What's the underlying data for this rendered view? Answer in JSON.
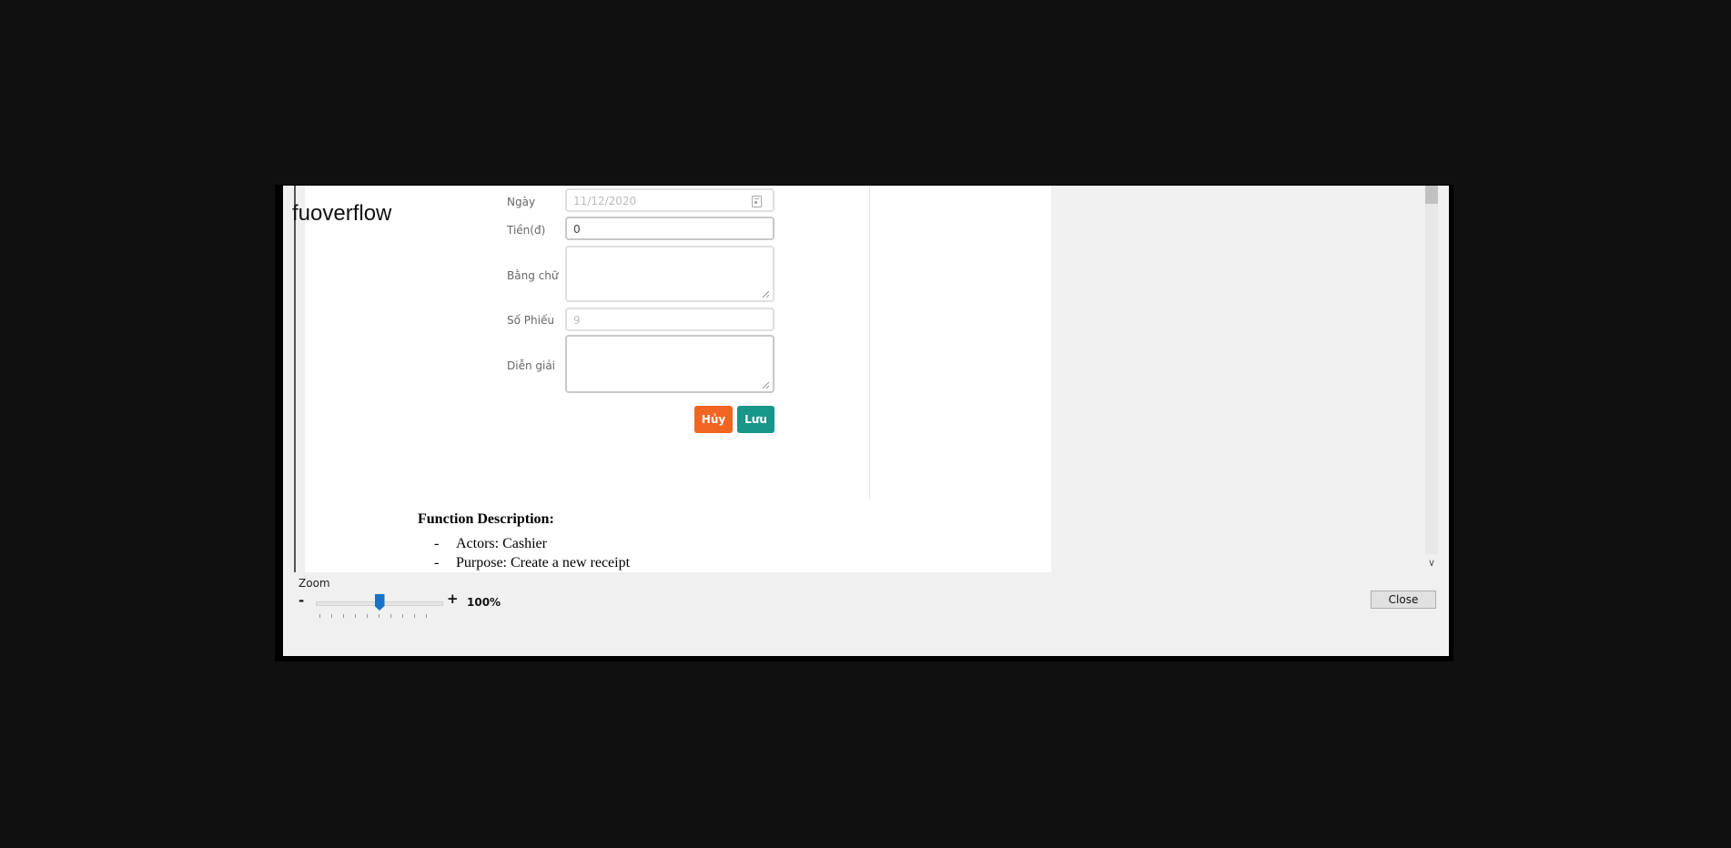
{
  "watermark": "fuoverflow",
  "form": {
    "date_label": "Ngày",
    "date_value": "11/12/2020",
    "amount_label": "Tiền(đ)",
    "amount_value": "0",
    "words_label": "Bằng chữ",
    "words_value": "",
    "receipt_no_label": "Số Phiếu",
    "receipt_no_value": "9",
    "explanation_label": "Diễn giải",
    "explanation_value": "",
    "cancel_label": "Hủy",
    "save_label": "Lưu",
    "colors": {
      "cancel": "#f26422",
      "save": "#17968a"
    }
  },
  "document": {
    "heading": "Function Description:",
    "bullets": [
      {
        "dash": "-",
        "text": "Actors: Cashier"
      },
      {
        "dash": "-",
        "text": "Purpose: Create a new receipt"
      }
    ]
  },
  "zoom": {
    "label": "Zoom",
    "minus": "-",
    "plus": "+",
    "value": "100%",
    "slider_fraction": 0.5
  },
  "close_label": "Close",
  "icons": {
    "calendar": "calendar-icon",
    "scroll_down": "chevron-down-icon"
  }
}
